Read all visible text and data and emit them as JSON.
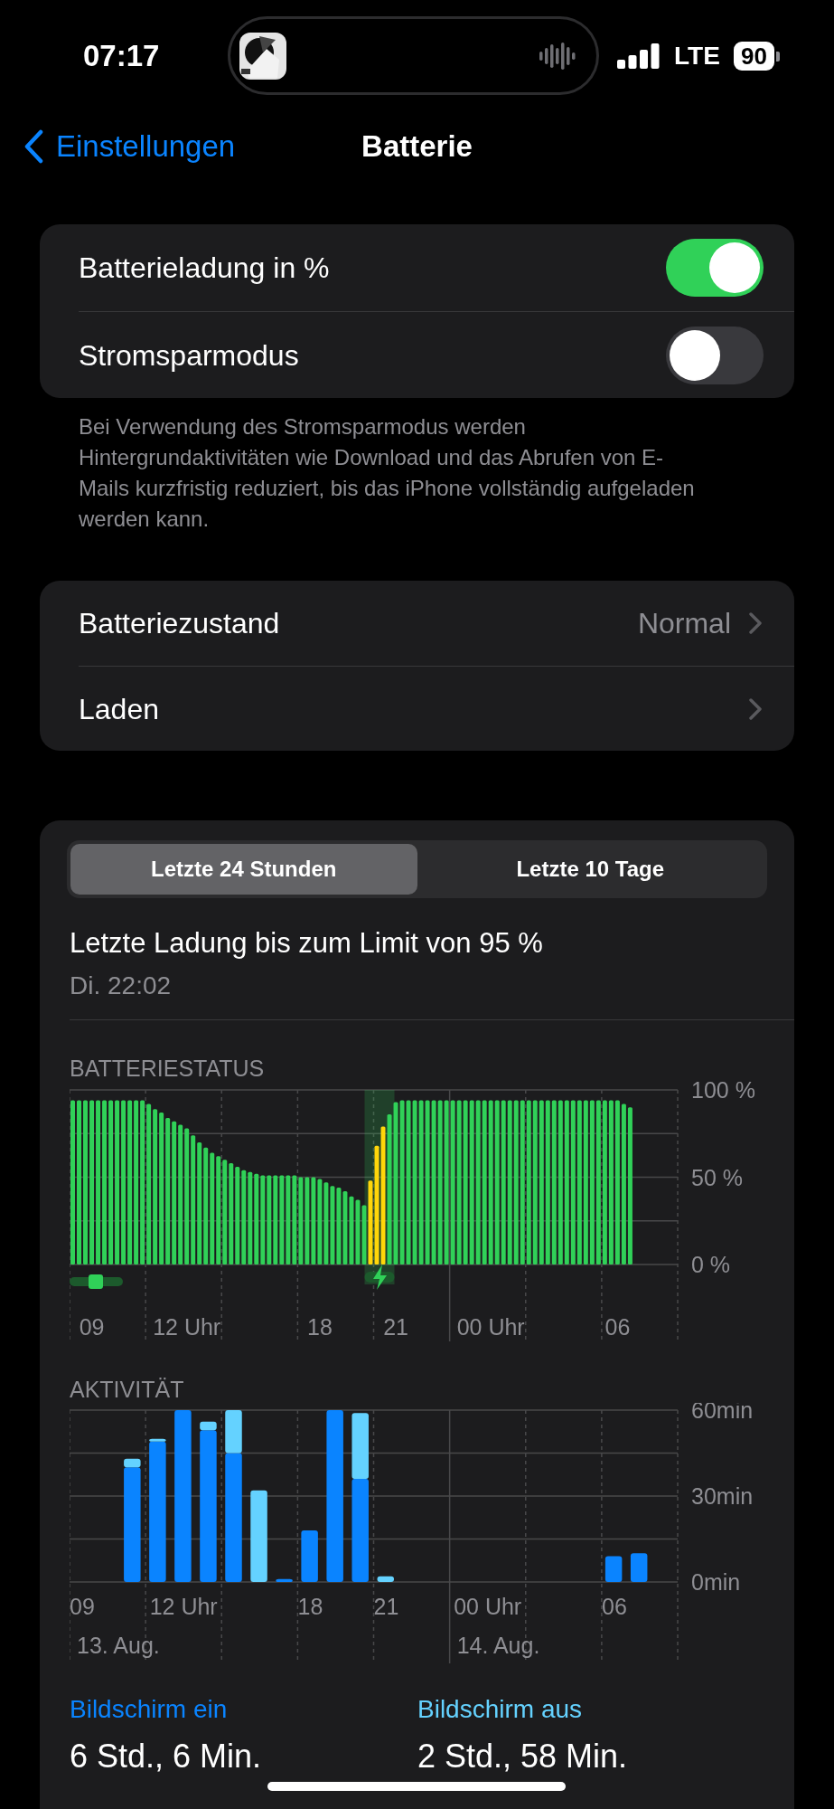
{
  "status_bar": {
    "time": "07:17",
    "network": "LTE",
    "battery": "90"
  },
  "nav": {
    "back": "Einstellungen",
    "title": "Batterie"
  },
  "toggles": [
    {
      "label": "Batterieladung in %",
      "on": true
    },
    {
      "label": "Stromsparmodus",
      "on": false
    }
  ],
  "toggles_footer": "Bei Verwendung des Stromsparmodus werden Hintergrundaktivitäten wie Download und das Abrufen von E-Mails kurzfristig reduziert, bis das iPhone vollständig aufgeladen werden kann.",
  "links": [
    {
      "label": "Batteriezustand",
      "value": "Normal"
    },
    {
      "label": "Laden"
    }
  ],
  "usage": {
    "tabs": [
      {
        "label": "Letzte 24 Stunden",
        "selected": true
      },
      {
        "label": "Letzte 10 Tage",
        "selected": false
      }
    ],
    "last_charge": "Letzte Ladung bis zum Limit von 95 %",
    "last_charge_time": "Di. 22:02",
    "battery_level": {
      "chart_data": {
        "type": "bar",
        "title": "BATTERIESTATUS",
        "grid": true,
        "ylim": [
          0,
          100
        ],
        "categories": [
          null,
          null,
          null,
          "09",
          null,
          null,
          null,
          null,
          null,
          null,
          null,
          null,
          null,
          null,
          null,
          null,
          null,
          null,
          "12 Uhr",
          null,
          null,
          null,
          null,
          null,
          null,
          null,
          null,
          null,
          null,
          null,
          null,
          null,
          null,
          null,
          null,
          null,
          null,
          null,
          null,
          "18",
          null,
          null,
          null,
          null,
          null,
          null,
          null,
          null,
          null,
          null,
          null,
          "21",
          null,
          null,
          null,
          null,
          null,
          null,
          null,
          null,
          null,
          null,
          null,
          null,
          null,
          null,
          "00 Uhr",
          null,
          null,
          null,
          null,
          null,
          null,
          null,
          null,
          null,
          null,
          null,
          null,
          null,
          null,
          null,
          null,
          null,
          null,
          null,
          "06",
          null,
          null,
          null,
          null,
          null,
          null,
          null,
          null,
          null
        ],
        "yticks": [
          {
            "value": 0,
            "label": "0 %"
          },
          {
            "value": 50,
            "label": "50 %"
          },
          {
            "value": 100,
            "label": "100 %"
          }
        ],
        "series": [
          {
            "color": "#30d158",
            "values": [
              94,
              94,
              94,
              94,
              94,
              94,
              94,
              94,
              94,
              94,
              94,
              94,
              92,
              89,
              87,
              84,
              82,
              80,
              78,
              74,
              70,
              67,
              64,
              62,
              60,
              58,
              56,
              54,
              53,
              52,
              51,
              51,
              51,
              51,
              51,
              51,
              50,
              50,
              50,
              49,
              47,
              45,
              44,
              42,
              39,
              37,
              34,
              null,
              null,
              null,
              86,
              93,
              94,
              94,
              94,
              94,
              94,
              94,
              94,
              94,
              94,
              94,
              94,
              94,
              94,
              94,
              94,
              94,
              94,
              94,
              94,
              94,
              94,
              94,
              94,
              94,
              94,
              94,
              94,
              94,
              94,
              94,
              94,
              94,
              94,
              94,
              94,
              92,
              90,
              null,
              null,
              null,
              null,
              null,
              null,
              null
            ]
          },
          {
            "color": "#ffd60a",
            "values": [
              null,
              null,
              null,
              null,
              null,
              null,
              null,
              null,
              null,
              null,
              null,
              null,
              null,
              null,
              null,
              null,
              null,
              null,
              null,
              null,
              null,
              null,
              null,
              null,
              null,
              null,
              null,
              null,
              null,
              null,
              null,
              null,
              null,
              null,
              null,
              null,
              null,
              null,
              null,
              null,
              null,
              null,
              null,
              null,
              null,
              null,
              null,
              48,
              68,
              79,
              null,
              null,
              null,
              null,
              null,
              null,
              null,
              null,
              null,
              null,
              null,
              null,
              null,
              null,
              null,
              null,
              null,
              null,
              null,
              null,
              null,
              null,
              null,
              null,
              null,
              null,
              null,
              null,
              null,
              null,
              null,
              null,
              null,
              null,
              null,
              null,
              null,
              null,
              null,
              null,
              null,
              null,
              null,
              null,
              null,
              null
            ]
          }
        ]
      }
    },
    "activity": {
      "chart_data": {
        "type": "bar",
        "title": "AKTIVITÄT",
        "stacked": true,
        "grid": true,
        "ylim": [
          0,
          60
        ],
        "categories": [
          "09",
          null,
          null,
          null,
          "12 Uhr",
          null,
          null,
          null,
          null,
          "18",
          null,
          null,
          "21",
          null,
          null,
          null,
          "00 Uhr",
          null,
          null,
          null,
          null,
          "06",
          null,
          null
        ],
        "yticks": [
          {
            "value": 0,
            "label": "0min"
          },
          {
            "value": 30,
            "label": "30min"
          },
          {
            "value": 60,
            "label": "60min"
          }
        ],
        "annotations": [
          "13. Aug.",
          "14. Aug."
        ],
        "series": [
          {
            "name": "Bildschirm ein",
            "color": "#0a84ff",
            "values": [
              0,
              0,
              40,
              49,
              60,
              53,
              45,
              0,
              1,
              18,
              60,
              36,
              0,
              0,
              0,
              0,
              0,
              0,
              0,
              0,
              0,
              9,
              10,
              0
            ]
          },
          {
            "name": "Bildschirm aus",
            "color": "#64d2ff",
            "values": [
              0,
              0,
              3,
              1,
              0,
              3,
              15,
              32,
              0,
              0,
              0,
              23,
              2,
              0,
              0,
              0,
              0,
              0,
              0,
              0,
              0,
              0,
              0,
              0
            ]
          }
        ]
      }
    },
    "legend": [
      {
        "value": "6 Std., 6 Min."
      },
      {
        "value": "2 Std., 58 Min."
      }
    ]
  }
}
